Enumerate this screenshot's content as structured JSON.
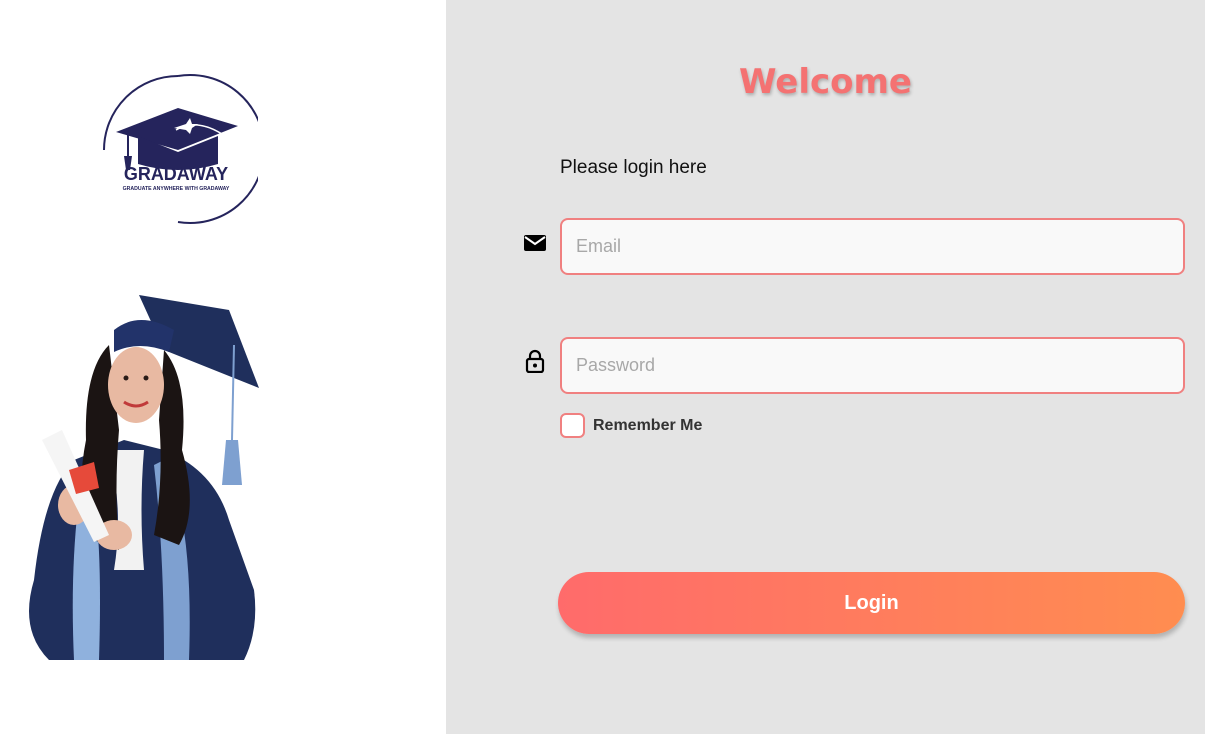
{
  "brand": {
    "logo_name": "GRADAWAY",
    "logo_tagline": "GRADUATE ANYWHERE WITH GRADAWAY",
    "colors": {
      "navy": "#25245c",
      "accent": "#f47272",
      "panel_bg": "#e4e4e4"
    }
  },
  "login": {
    "title": "Welcome",
    "subtitle": "Please login here",
    "email_placeholder": "Email",
    "email_value": "",
    "password_placeholder": "Password",
    "password_value": "",
    "remember_label": "Remember Me",
    "remember_checked": false,
    "submit_label": "Login"
  },
  "icons": {
    "email": "envelope-icon",
    "password": "lock-icon"
  }
}
